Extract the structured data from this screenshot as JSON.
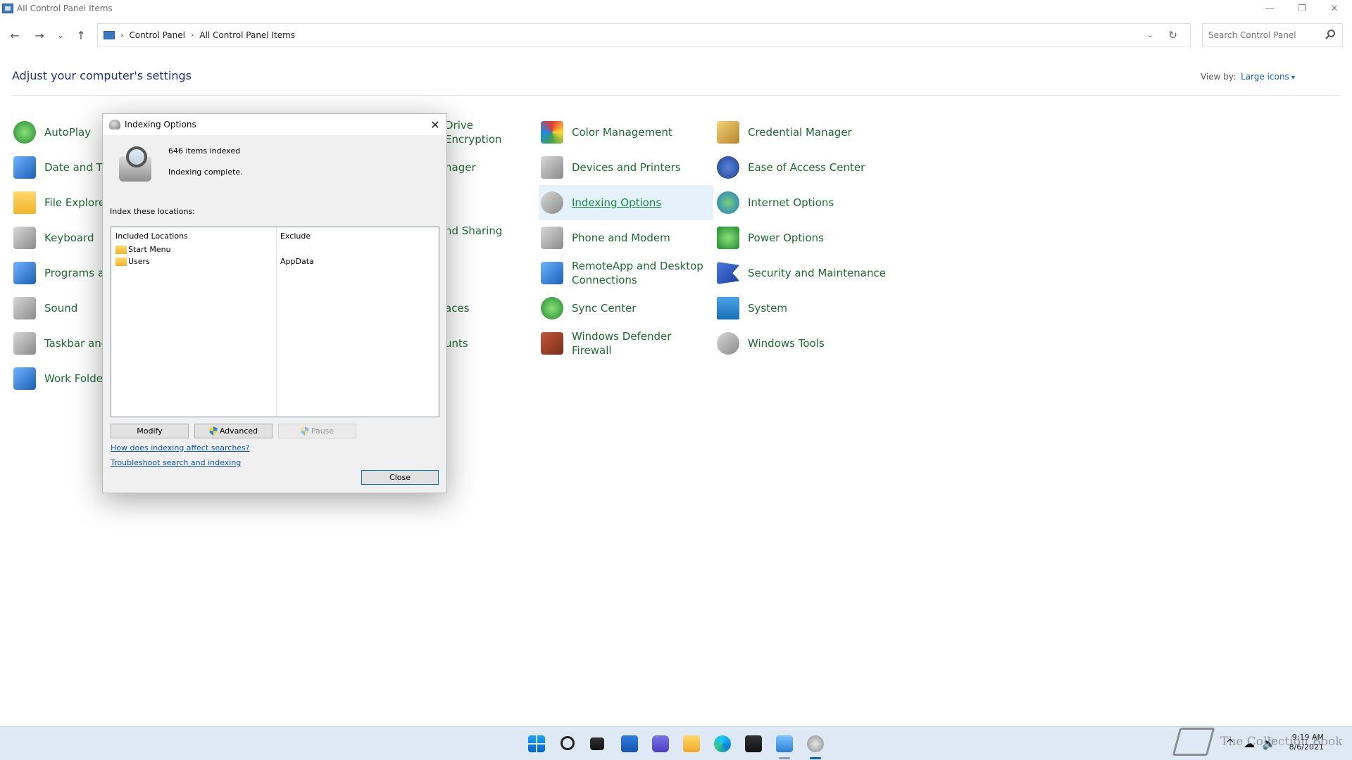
{
  "window": {
    "title": "All Control Panel Items",
    "minimize_glyph": "—",
    "restore_glyph": "❐",
    "close_glyph": "✕"
  },
  "nav": {
    "back_glyph": "←",
    "forward_glyph": "→",
    "recent_glyph": "⌄",
    "up_glyph": "↑"
  },
  "address": {
    "crumbs": [
      "Control Panel",
      "All Control Panel Items"
    ],
    "separator": "›",
    "dropdown_glyph": "⌄",
    "refresh_glyph": "↻"
  },
  "search": {
    "placeholder": "Search Control Panel"
  },
  "header": {
    "title": "Adjust your computer's settings",
    "viewby_label": "View by:",
    "viewby_value": "Large icons"
  },
  "items": [
    {
      "label": "AutoPlay",
      "icon": "autoplay-icon"
    },
    {
      "label": "Date and Tir",
      "icon": "calendar-icon"
    },
    {
      "label": "File Explorer",
      "icon": "folder-icon"
    },
    {
      "label": "Keyboard",
      "icon": "keyboard-icon"
    },
    {
      "label": "Programs ar",
      "icon": "programs-icon"
    },
    {
      "label": "Sound",
      "icon": "speaker-icon"
    },
    {
      "label": "Taskbar and",
      "icon": "taskbar-icon"
    },
    {
      "label": "Work Folder",
      "icon": "work-folders-icon"
    },
    {
      "label": "Drive Encryption",
      "icon": "drive-lock-icon"
    },
    {
      "label": "nager",
      "icon": "manager-icon"
    },
    {
      "label": "nd Sharing",
      "icon": "network-icon"
    },
    {
      "label": "aces",
      "icon": "storage-icon"
    },
    {
      "label": "unts",
      "icon": "accounts-icon"
    },
    {
      "label": "Color Management",
      "icon": "color-icon"
    },
    {
      "label": "Devices and Printers",
      "icon": "printer-icon"
    },
    {
      "label": "Indexing Options",
      "icon": "indexing-icon"
    },
    {
      "label": "Phone and Modem",
      "icon": "phone-icon"
    },
    {
      "label": "RemoteApp and Desktop Connections",
      "icon": "remoteapp-icon"
    },
    {
      "label": "Sync Center",
      "icon": "sync-icon"
    },
    {
      "label": "Windows Defender Firewall",
      "icon": "firewall-icon"
    },
    {
      "label": "Credential Manager",
      "icon": "credential-icon"
    },
    {
      "label": "Ease of Access Center",
      "icon": "accessibility-icon"
    },
    {
      "label": "Internet Options",
      "icon": "internet-icon"
    },
    {
      "label": "Power Options",
      "icon": "power-icon"
    },
    {
      "label": "Security and Maintenance",
      "icon": "flag-icon"
    },
    {
      "label": "System",
      "icon": "monitor-icon"
    },
    {
      "label": "Windows Tools",
      "icon": "gears-icon"
    }
  ],
  "dialog": {
    "title": "Indexing Options",
    "close_glyph": "✕",
    "items_indexed": "646 items indexed",
    "status": "Indexing complete.",
    "locations_label": "Index these locations:",
    "col_included": "Included Locations",
    "col_exclude": "Exclude",
    "locations": [
      {
        "name": "Start Menu",
        "exclude": ""
      },
      {
        "name": "Users",
        "exclude": "AppData"
      }
    ],
    "modify_label": "Modify",
    "advanced_label": "Advanced",
    "pause_label": "Pause",
    "link_help": "How does indexing affect searches?",
    "link_troubleshoot": "Troubleshoot search and indexing",
    "close_label": "Close"
  },
  "taskbar": {
    "tray_glyphs": [
      "^",
      "☁",
      "🔊"
    ],
    "time": "9:19 AM",
    "date": "8/6/2021"
  },
  "watermark": "The Collection Book"
}
